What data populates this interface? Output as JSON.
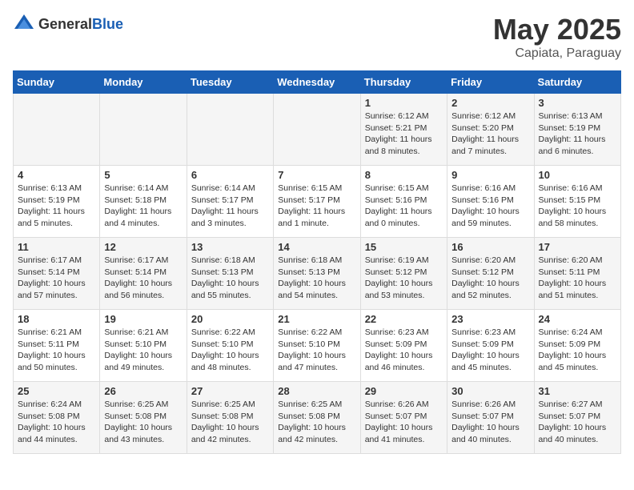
{
  "header": {
    "logo_general": "General",
    "logo_blue": "Blue",
    "title": "May 2025",
    "location": "Capiata, Paraguay"
  },
  "weekdays": [
    "Sunday",
    "Monday",
    "Tuesday",
    "Wednesday",
    "Thursday",
    "Friday",
    "Saturday"
  ],
  "weeks": [
    [
      {
        "day": "",
        "info": ""
      },
      {
        "day": "",
        "info": ""
      },
      {
        "day": "",
        "info": ""
      },
      {
        "day": "",
        "info": ""
      },
      {
        "day": "1",
        "info": "Sunrise: 6:12 AM\nSunset: 5:21 PM\nDaylight: 11 hours and 8 minutes."
      },
      {
        "day": "2",
        "info": "Sunrise: 6:12 AM\nSunset: 5:20 PM\nDaylight: 11 hours and 7 minutes."
      },
      {
        "day": "3",
        "info": "Sunrise: 6:13 AM\nSunset: 5:19 PM\nDaylight: 11 hours and 6 minutes."
      }
    ],
    [
      {
        "day": "4",
        "info": "Sunrise: 6:13 AM\nSunset: 5:19 PM\nDaylight: 11 hours and 5 minutes."
      },
      {
        "day": "5",
        "info": "Sunrise: 6:14 AM\nSunset: 5:18 PM\nDaylight: 11 hours and 4 minutes."
      },
      {
        "day": "6",
        "info": "Sunrise: 6:14 AM\nSunset: 5:17 PM\nDaylight: 11 hours and 3 minutes."
      },
      {
        "day": "7",
        "info": "Sunrise: 6:15 AM\nSunset: 5:17 PM\nDaylight: 11 hours and 1 minute."
      },
      {
        "day": "8",
        "info": "Sunrise: 6:15 AM\nSunset: 5:16 PM\nDaylight: 11 hours and 0 minutes."
      },
      {
        "day": "9",
        "info": "Sunrise: 6:16 AM\nSunset: 5:16 PM\nDaylight: 10 hours and 59 minutes."
      },
      {
        "day": "10",
        "info": "Sunrise: 6:16 AM\nSunset: 5:15 PM\nDaylight: 10 hours and 58 minutes."
      }
    ],
    [
      {
        "day": "11",
        "info": "Sunrise: 6:17 AM\nSunset: 5:14 PM\nDaylight: 10 hours and 57 minutes."
      },
      {
        "day": "12",
        "info": "Sunrise: 6:17 AM\nSunset: 5:14 PM\nDaylight: 10 hours and 56 minutes."
      },
      {
        "day": "13",
        "info": "Sunrise: 6:18 AM\nSunset: 5:13 PM\nDaylight: 10 hours and 55 minutes."
      },
      {
        "day": "14",
        "info": "Sunrise: 6:18 AM\nSunset: 5:13 PM\nDaylight: 10 hours and 54 minutes."
      },
      {
        "day": "15",
        "info": "Sunrise: 6:19 AM\nSunset: 5:12 PM\nDaylight: 10 hours and 53 minutes."
      },
      {
        "day": "16",
        "info": "Sunrise: 6:20 AM\nSunset: 5:12 PM\nDaylight: 10 hours and 52 minutes."
      },
      {
        "day": "17",
        "info": "Sunrise: 6:20 AM\nSunset: 5:11 PM\nDaylight: 10 hours and 51 minutes."
      }
    ],
    [
      {
        "day": "18",
        "info": "Sunrise: 6:21 AM\nSunset: 5:11 PM\nDaylight: 10 hours and 50 minutes."
      },
      {
        "day": "19",
        "info": "Sunrise: 6:21 AM\nSunset: 5:10 PM\nDaylight: 10 hours and 49 minutes."
      },
      {
        "day": "20",
        "info": "Sunrise: 6:22 AM\nSunset: 5:10 PM\nDaylight: 10 hours and 48 minutes."
      },
      {
        "day": "21",
        "info": "Sunrise: 6:22 AM\nSunset: 5:10 PM\nDaylight: 10 hours and 47 minutes."
      },
      {
        "day": "22",
        "info": "Sunrise: 6:23 AM\nSunset: 5:09 PM\nDaylight: 10 hours and 46 minutes."
      },
      {
        "day": "23",
        "info": "Sunrise: 6:23 AM\nSunset: 5:09 PM\nDaylight: 10 hours and 45 minutes."
      },
      {
        "day": "24",
        "info": "Sunrise: 6:24 AM\nSunset: 5:09 PM\nDaylight: 10 hours and 45 minutes."
      }
    ],
    [
      {
        "day": "25",
        "info": "Sunrise: 6:24 AM\nSunset: 5:08 PM\nDaylight: 10 hours and 44 minutes."
      },
      {
        "day": "26",
        "info": "Sunrise: 6:25 AM\nSunset: 5:08 PM\nDaylight: 10 hours and 43 minutes."
      },
      {
        "day": "27",
        "info": "Sunrise: 6:25 AM\nSunset: 5:08 PM\nDaylight: 10 hours and 42 minutes."
      },
      {
        "day": "28",
        "info": "Sunrise: 6:25 AM\nSunset: 5:08 PM\nDaylight: 10 hours and 42 minutes."
      },
      {
        "day": "29",
        "info": "Sunrise: 6:26 AM\nSunset: 5:07 PM\nDaylight: 10 hours and 41 minutes."
      },
      {
        "day": "30",
        "info": "Sunrise: 6:26 AM\nSunset: 5:07 PM\nDaylight: 10 hours and 40 minutes."
      },
      {
        "day": "31",
        "info": "Sunrise: 6:27 AM\nSunset: 5:07 PM\nDaylight: 10 hours and 40 minutes."
      }
    ]
  ]
}
